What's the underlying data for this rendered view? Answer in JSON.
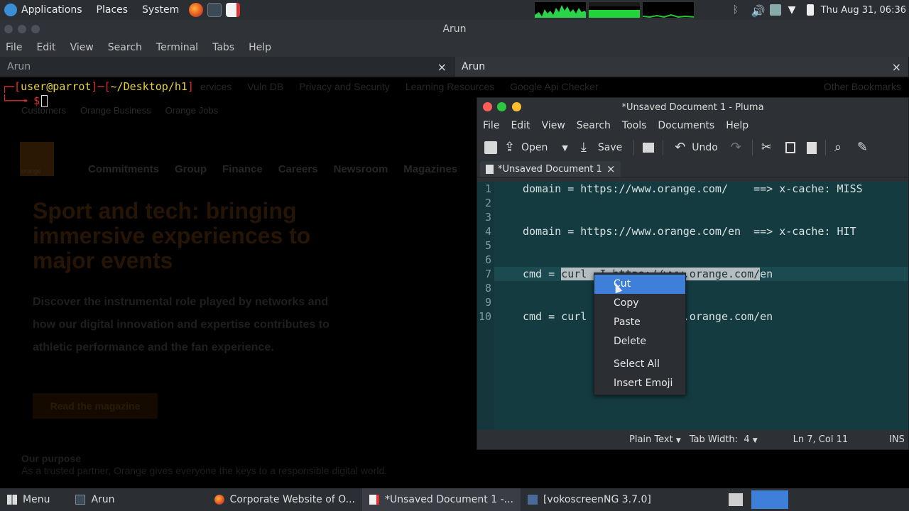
{
  "top_panel": {
    "applications": "Applications",
    "places": "Places",
    "system": "System",
    "clock": "Thu Aug 31, 06:36"
  },
  "terminal": {
    "title": "Arun",
    "menu": [
      "File",
      "Edit",
      "View",
      "Search",
      "Terminal",
      "Tabs",
      "Help"
    ],
    "tabs": [
      {
        "label": "Arun",
        "close": "×"
      },
      {
        "label": "Arun",
        "close": "×"
      }
    ],
    "prompt": {
      "open": "┌─[",
      "user": "user@parrot",
      "sep": "]─[",
      "path": "~/Desktop/h1",
      "close": "]",
      "line2": "└──╼ $"
    }
  },
  "background_page": {
    "bookmarks": [
      "ervices",
      "Vuln DB",
      "Privacy and Security",
      "Learning Resources",
      "Google Api Checker",
      "Other Bookmarks"
    ],
    "subnav": [
      "Customers",
      "Orange Business",
      "Orange Jobs"
    ],
    "logo": "orange",
    "nav": [
      "Commitments",
      "Group",
      "Finance",
      "Careers",
      "Newsroom",
      "Magazines"
    ],
    "headline": [
      "Sport and tech: bringing",
      "immersive experiences to",
      "major events"
    ],
    "body": [
      "Discover the instrumental role played by networks and",
      "how our digital innovation and expertise contributes to",
      "athletic performance and the fan experience."
    ],
    "button": "Read the magazine",
    "purpose_title": "Our purpose",
    "purpose_text": "As a trusted partner, Orange gives everyone the keys to a responsible digital world."
  },
  "pluma": {
    "title": "*Unsaved Document 1 - Pluma",
    "menu": [
      "File",
      "Edit",
      "View",
      "Search",
      "Tools",
      "Documents",
      "Help"
    ],
    "toolbar": {
      "open": "Open",
      "save": "Save",
      "undo": "Undo"
    },
    "tab_label": "*Unsaved Document 1",
    "tab_close": "×",
    "line_numbers": [
      "1",
      "2",
      "3",
      "4",
      "5",
      "6",
      "7",
      "8",
      "9",
      "10"
    ],
    "lines": [
      "domain = https://www.orange.com/    ==> x-cache: MISS",
      "",
      "",
      "domain = https://www.orange.com/en  ==> x-cache: HIT",
      "",
      "",
      "",
      "",
      "",
      "cmd = curl -I https://www.orange.com/en"
    ],
    "line7": {
      "prefix": "cmd = ",
      "selected": "curl -I https://www.orange.com/",
      "suffix": "en"
    },
    "status": {
      "language": "Plain Text",
      "tab_width": "Tab Width:  4",
      "position": "Ln 7, Col 11",
      "mode": "INS"
    }
  },
  "context_menu": [
    "Cut",
    "Copy",
    "Paste",
    "Delete",
    "Select All",
    "Insert Emoji"
  ],
  "taskbar": {
    "menu": "Menu",
    "items": [
      "Arun",
      "Corporate Website of O...",
      "*Unsaved Document 1 -...",
      "[vokoscreenNG 3.7.0]"
    ]
  },
  "colors": {
    "panel": "#2b2e33",
    "editor_bg": "#143b40",
    "highlight": "#3d7fd9",
    "prompt_red": "#e0302a",
    "prompt_yellow": "#e6d23c"
  }
}
